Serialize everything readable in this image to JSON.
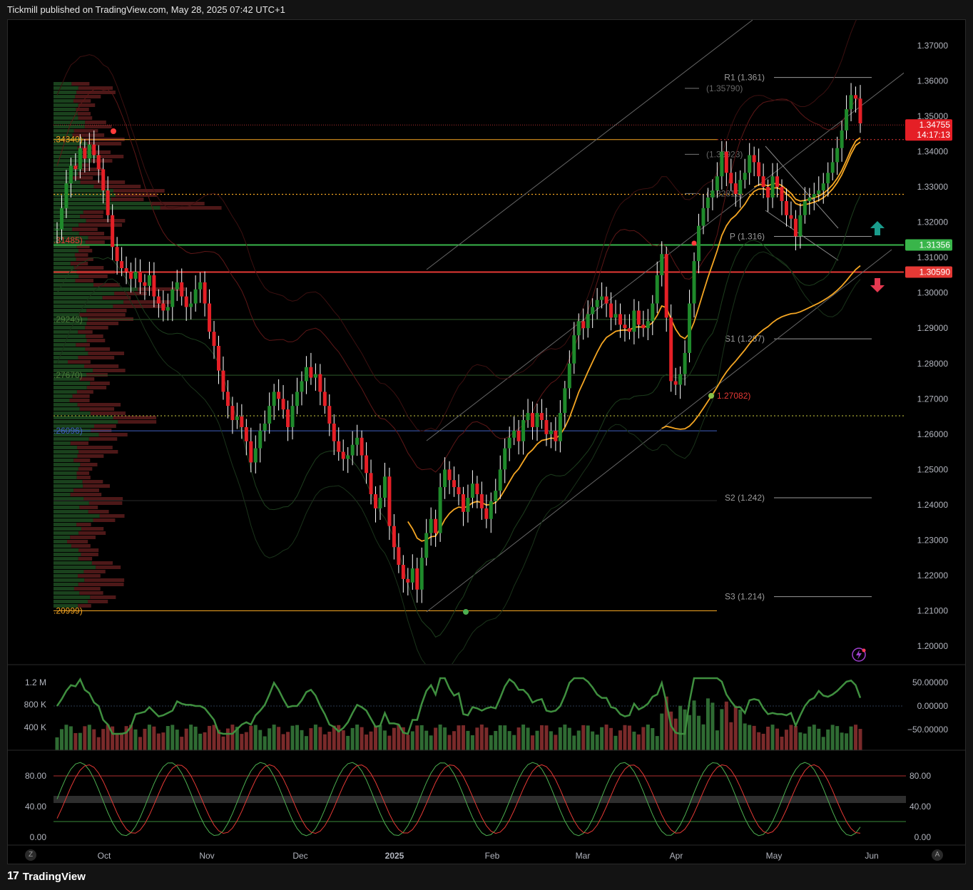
{
  "header": {
    "publisher_line": "Tickmill published on TradingView.com, May 28, 2025 07:42 UTC+1"
  },
  "footer": {
    "brand": "TradingView",
    "logo": "17"
  },
  "nav": {
    "left_btn": "Z",
    "right_btn": "A"
  },
  "colors": {
    "up": "#1f8a2b",
    "down": "#e51f26",
    "ema": "#f5a623",
    "band": "#7a1a1a",
    "support": "#39b54a",
    "resistance": "#e53935",
    "channel": "#6b6b6b"
  },
  "chart_data": [
    {
      "type": "candlestick",
      "symbol_note": "price panel",
      "ylim": [
        1.193,
        1.378
      ],
      "y_ticks": [
        "1.37000",
        "1.36000",
        "1.35000",
        "1.34000",
        "1.33000",
        "1.32000",
        "1.31000",
        "1.30000",
        "1.29000",
        "1.28000",
        "1.27000",
        "1.26000",
        "1.25000",
        "1.24000",
        "1.23000",
        "1.22000",
        "1.21000",
        "1.20000"
      ],
      "x_ticks": [
        "Oct",
        "Nov",
        "Dec",
        "2025",
        "Feb",
        "Mar",
        "Apr",
        "May",
        "Jun"
      ],
      "price_tags": [
        {
          "label": "1.34755",
          "sub": "14:17:13",
          "value": 1.34755,
          "color": "#e51f26"
        },
        {
          "label": "1.31356",
          "value": 1.31356,
          "color": "#39b54a"
        },
        {
          "label": "1.30590",
          "value": 1.3059,
          "color": "#e53935"
        }
      ],
      "pivots": [
        {
          "label": "R1 (1.361)",
          "value": 1.361
        },
        {
          "label": "P (1.316)",
          "value": 1.316
        },
        {
          "label": "S1 (1.287)",
          "value": 1.287
        },
        {
          "label": "S2 (1.242)",
          "value": 1.242
        },
        {
          "label": "S3 (1.214)",
          "value": 1.214
        }
      ],
      "fib_labels": [
        {
          "label": "(1.35790)",
          "value": 1.3579
        },
        {
          "label": "(1.33923)",
          "value": 1.33923
        },
        {
          "label": "(1.32812)",
          "value": 1.32812
        }
      ],
      "level_labels": [
        {
          "label": ".34340)",
          "value": 1.3434,
          "color": "#f5a623"
        },
        {
          "label": ".31485)",
          "value": 1.31485,
          "color": "#e53935"
        },
        {
          "label": ".29246)",
          "value": 1.29246,
          "color": "#4b7d3a"
        },
        {
          "label": ".27670)",
          "value": 1.2767,
          "color": "#4b7d3a"
        },
        {
          "label": ".26096)",
          "value": 1.26096,
          "color": "#3f5fbf"
        },
        {
          "label": ".20999)",
          "value": 1.20999,
          "color": "#f5a623"
        },
        {
          "label": "1.27082)",
          "value": 1.27082,
          "color": "#e53935"
        }
      ],
      "closes": [
        1.318,
        1.324,
        1.331,
        1.336,
        1.335,
        1.341,
        1.338,
        1.342,
        1.339,
        1.335,
        1.329,
        1.322,
        1.313,
        1.309,
        1.307,
        1.306,
        1.304,
        1.306,
        1.303,
        1.302,
        1.305,
        1.299,
        1.297,
        1.295,
        1.296,
        1.301,
        1.303,
        1.299,
        1.296,
        1.297,
        1.301,
        1.303,
        1.297,
        1.289,
        1.285,
        1.278,
        1.272,
        1.268,
        1.264,
        1.265,
        1.262,
        1.258,
        1.252,
        1.256,
        1.261,
        1.263,
        1.268,
        1.272,
        1.27,
        1.267,
        1.262,
        1.268,
        1.272,
        1.275,
        1.279,
        1.276,
        1.277,
        1.272,
        1.268,
        1.263,
        1.258,
        1.255,
        1.253,
        1.254,
        1.257,
        1.259,
        1.254,
        1.249,
        1.243,
        1.239,
        1.242,
        1.248,
        1.234,
        1.228,
        1.223,
        1.219,
        1.218,
        1.222,
        1.216,
        1.225,
        1.232,
        1.236,
        1.232,
        1.245,
        1.25,
        1.247,
        1.245,
        1.243,
        1.238,
        1.242,
        1.246,
        1.243,
        1.239,
        1.236,
        1.241,
        1.244,
        1.25,
        1.256,
        1.259,
        1.261,
        1.258,
        1.264,
        1.266,
        1.262,
        1.266,
        1.264,
        1.26,
        1.261,
        1.258,
        1.266,
        1.273,
        1.28,
        1.288,
        1.292,
        1.29,
        1.294,
        1.296,
        1.298,
        1.299,
        1.297,
        1.293,
        1.294,
        1.291,
        1.29,
        1.289,
        1.295,
        1.291,
        1.29,
        1.292,
        1.297,
        1.305,
        1.311,
        1.293,
        1.275,
        1.274,
        1.277,
        1.283,
        1.297,
        1.309,
        1.319,
        1.324,
        1.327,
        1.329,
        1.333,
        1.34,
        1.334,
        1.331,
        1.328,
        1.332,
        1.334,
        1.339,
        1.337,
        1.333,
        1.33,
        1.327,
        1.333,
        1.33,
        1.326,
        1.322,
        1.321,
        1.316,
        1.322,
        1.326,
        1.327,
        1.328,
        1.329,
        1.331,
        1.334,
        1.337,
        1.341,
        1.346,
        1.352,
        1.356,
        1.355,
        1.348
      ]
    },
    {
      "type": "bar",
      "symbol_note": "volume panel with oscillator overlay",
      "y_ticks_left": [
        "1.2 M",
        "800 K",
        "400 K"
      ],
      "y_ticks_right": [
        "50.00000",
        "0.00000",
        "−50.00000"
      ]
    },
    {
      "type": "line",
      "symbol_note": "stochastic panel",
      "y_ticks_left": [
        "80.00",
        "40.00",
        "0.00"
      ],
      "y_ticks_right": [
        "80.00",
        "40.00",
        "0.00"
      ]
    }
  ]
}
